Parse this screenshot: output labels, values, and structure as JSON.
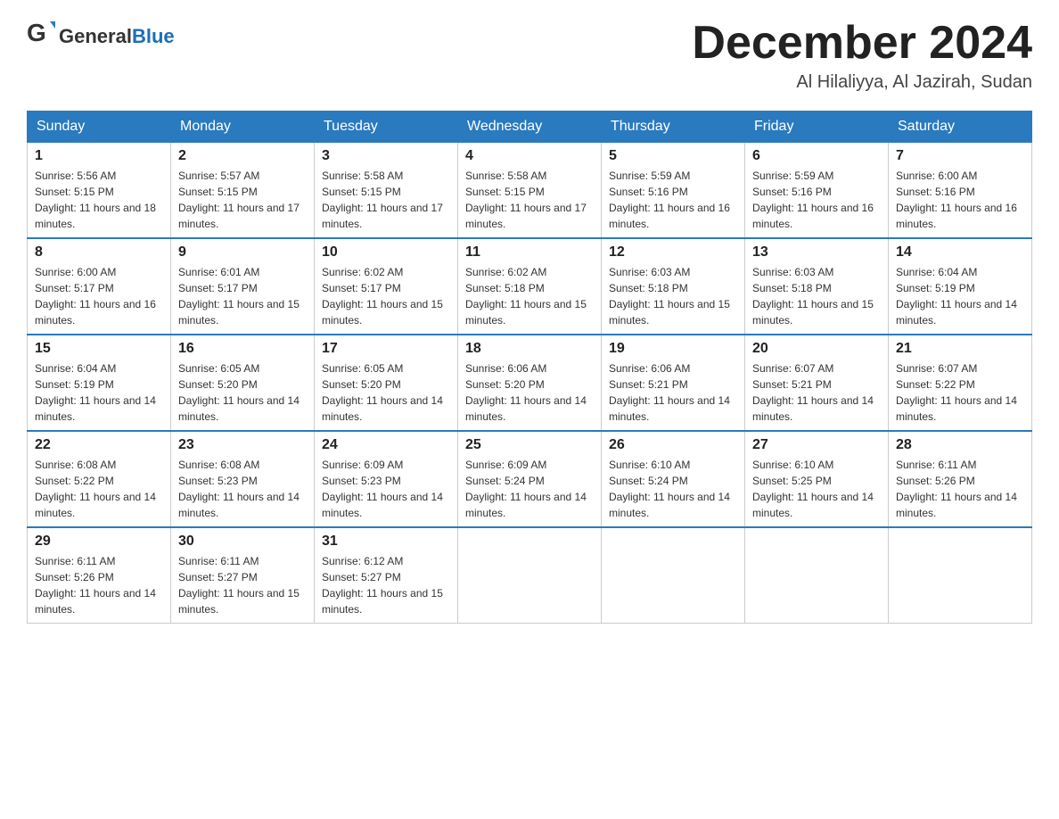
{
  "header": {
    "logo_general": "General",
    "logo_blue": "Blue",
    "month_title": "December 2024",
    "location": "Al Hilaliyya, Al Jazirah, Sudan"
  },
  "days_of_week": [
    "Sunday",
    "Monday",
    "Tuesday",
    "Wednesday",
    "Thursday",
    "Friday",
    "Saturday"
  ],
  "weeks": [
    [
      {
        "day": "1",
        "sunrise": "5:56 AM",
        "sunset": "5:15 PM",
        "daylight": "11 hours and 18 minutes."
      },
      {
        "day": "2",
        "sunrise": "5:57 AM",
        "sunset": "5:15 PM",
        "daylight": "11 hours and 17 minutes."
      },
      {
        "day": "3",
        "sunrise": "5:58 AM",
        "sunset": "5:15 PM",
        "daylight": "11 hours and 17 minutes."
      },
      {
        "day": "4",
        "sunrise": "5:58 AM",
        "sunset": "5:15 PM",
        "daylight": "11 hours and 17 minutes."
      },
      {
        "day": "5",
        "sunrise": "5:59 AM",
        "sunset": "5:16 PM",
        "daylight": "11 hours and 16 minutes."
      },
      {
        "day": "6",
        "sunrise": "5:59 AM",
        "sunset": "5:16 PM",
        "daylight": "11 hours and 16 minutes."
      },
      {
        "day": "7",
        "sunrise": "6:00 AM",
        "sunset": "5:16 PM",
        "daylight": "11 hours and 16 minutes."
      }
    ],
    [
      {
        "day": "8",
        "sunrise": "6:00 AM",
        "sunset": "5:17 PM",
        "daylight": "11 hours and 16 minutes."
      },
      {
        "day": "9",
        "sunrise": "6:01 AM",
        "sunset": "5:17 PM",
        "daylight": "11 hours and 15 minutes."
      },
      {
        "day": "10",
        "sunrise": "6:02 AM",
        "sunset": "5:17 PM",
        "daylight": "11 hours and 15 minutes."
      },
      {
        "day": "11",
        "sunrise": "6:02 AM",
        "sunset": "5:18 PM",
        "daylight": "11 hours and 15 minutes."
      },
      {
        "day": "12",
        "sunrise": "6:03 AM",
        "sunset": "5:18 PM",
        "daylight": "11 hours and 15 minutes."
      },
      {
        "day": "13",
        "sunrise": "6:03 AM",
        "sunset": "5:18 PM",
        "daylight": "11 hours and 15 minutes."
      },
      {
        "day": "14",
        "sunrise": "6:04 AM",
        "sunset": "5:19 PM",
        "daylight": "11 hours and 14 minutes."
      }
    ],
    [
      {
        "day": "15",
        "sunrise": "6:04 AM",
        "sunset": "5:19 PM",
        "daylight": "11 hours and 14 minutes."
      },
      {
        "day": "16",
        "sunrise": "6:05 AM",
        "sunset": "5:20 PM",
        "daylight": "11 hours and 14 minutes."
      },
      {
        "day": "17",
        "sunrise": "6:05 AM",
        "sunset": "5:20 PM",
        "daylight": "11 hours and 14 minutes."
      },
      {
        "day": "18",
        "sunrise": "6:06 AM",
        "sunset": "5:20 PM",
        "daylight": "11 hours and 14 minutes."
      },
      {
        "day": "19",
        "sunrise": "6:06 AM",
        "sunset": "5:21 PM",
        "daylight": "11 hours and 14 minutes."
      },
      {
        "day": "20",
        "sunrise": "6:07 AM",
        "sunset": "5:21 PM",
        "daylight": "11 hours and 14 minutes."
      },
      {
        "day": "21",
        "sunrise": "6:07 AM",
        "sunset": "5:22 PM",
        "daylight": "11 hours and 14 minutes."
      }
    ],
    [
      {
        "day": "22",
        "sunrise": "6:08 AM",
        "sunset": "5:22 PM",
        "daylight": "11 hours and 14 minutes."
      },
      {
        "day": "23",
        "sunrise": "6:08 AM",
        "sunset": "5:23 PM",
        "daylight": "11 hours and 14 minutes."
      },
      {
        "day": "24",
        "sunrise": "6:09 AM",
        "sunset": "5:23 PM",
        "daylight": "11 hours and 14 minutes."
      },
      {
        "day": "25",
        "sunrise": "6:09 AM",
        "sunset": "5:24 PM",
        "daylight": "11 hours and 14 minutes."
      },
      {
        "day": "26",
        "sunrise": "6:10 AM",
        "sunset": "5:24 PM",
        "daylight": "11 hours and 14 minutes."
      },
      {
        "day": "27",
        "sunrise": "6:10 AM",
        "sunset": "5:25 PM",
        "daylight": "11 hours and 14 minutes."
      },
      {
        "day": "28",
        "sunrise": "6:11 AM",
        "sunset": "5:26 PM",
        "daylight": "11 hours and 14 minutes."
      }
    ],
    [
      {
        "day": "29",
        "sunrise": "6:11 AM",
        "sunset": "5:26 PM",
        "daylight": "11 hours and 14 minutes."
      },
      {
        "day": "30",
        "sunrise": "6:11 AM",
        "sunset": "5:27 PM",
        "daylight": "11 hours and 15 minutes."
      },
      {
        "day": "31",
        "sunrise": "6:12 AM",
        "sunset": "5:27 PM",
        "daylight": "11 hours and 15 minutes."
      },
      null,
      null,
      null,
      null
    ]
  ]
}
